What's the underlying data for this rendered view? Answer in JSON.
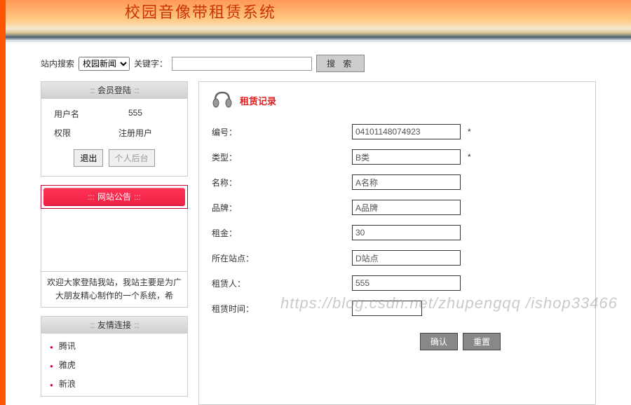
{
  "banner": {
    "title_fragment": "校园音像带租赁系统"
  },
  "search": {
    "site_label": "站内搜索",
    "select_value": "校园新闻",
    "keyword_label": "关键字：",
    "button_label": "搜 索"
  },
  "sidebar": {
    "login_panel": {
      "title": "会员登陆",
      "rows": [
        {
          "label": "用户名",
          "value": "555"
        },
        {
          "label": "权限",
          "value": "注册用户"
        }
      ],
      "logout_button": "退出",
      "profile_button": "个人后台"
    },
    "notice_panel": {
      "title": "网站公告",
      "text": "欢迎大家登陆我站，我站主要是为广大朋友精心制作的一个系统，希"
    },
    "links_panel": {
      "title": "友情连接",
      "items": [
        "腾讯",
        "雅虎",
        "新浪"
      ]
    }
  },
  "main": {
    "title": "租赁记录",
    "fields": [
      {
        "label": "编号：",
        "value": "04101148074923",
        "required": true,
        "short": false
      },
      {
        "label": "类型：",
        "value": "B类",
        "required": true,
        "short": false
      },
      {
        "label": "名称：",
        "value": "A名称",
        "required": false,
        "short": false
      },
      {
        "label": "品牌：",
        "value": "A品牌",
        "required": false,
        "short": false
      },
      {
        "label": "租金：",
        "value": "30",
        "required": false,
        "short": false
      },
      {
        "label": "所在站点：",
        "value": "D站点",
        "required": false,
        "short": false
      },
      {
        "label": "租赁人：",
        "value": "555",
        "required": false,
        "short": false
      },
      {
        "label": "租赁时间：",
        "value": "",
        "required": false,
        "short": true
      }
    ],
    "buttons": {
      "submit": "确认",
      "reset": "重置"
    }
  },
  "watermark": "https://blog.csdn.net/zhupengqq /ishop33466"
}
